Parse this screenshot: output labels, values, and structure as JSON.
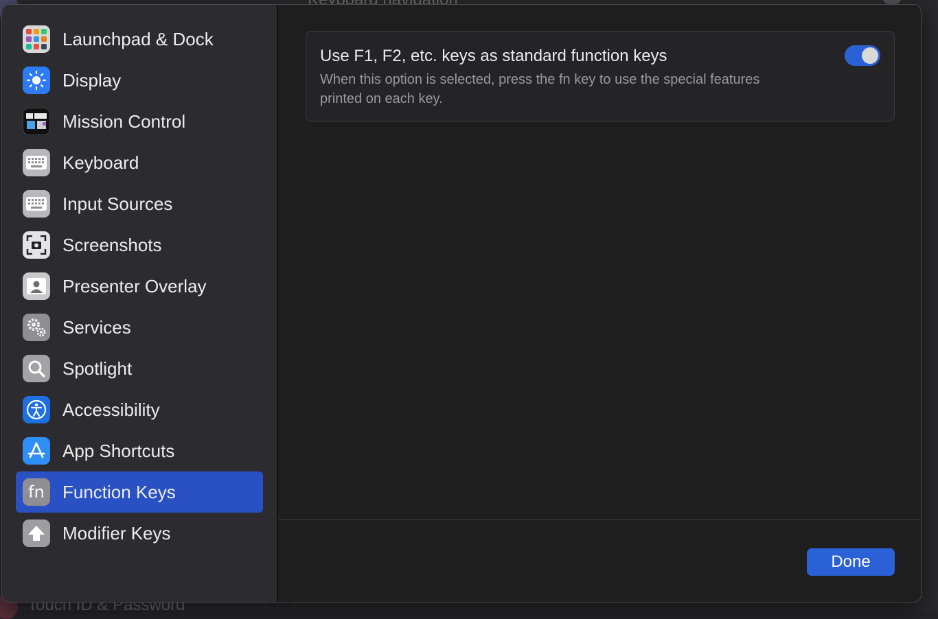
{
  "background": {
    "top_text": "Keyboard navigation",
    "bottom_text": "Touch ID & Password"
  },
  "sidebar": {
    "items": [
      {
        "label": "Launchpad & Dock",
        "icon": "launchpad-icon"
      },
      {
        "label": "Display",
        "icon": "display-icon"
      },
      {
        "label": "Mission Control",
        "icon": "mission-control-icon"
      },
      {
        "label": "Keyboard",
        "icon": "keyboard-icon"
      },
      {
        "label": "Input Sources",
        "icon": "input-sources-icon"
      },
      {
        "label": "Screenshots",
        "icon": "screenshots-icon"
      },
      {
        "label": "Presenter Overlay",
        "icon": "presenter-overlay-icon"
      },
      {
        "label": "Services",
        "icon": "services-icon"
      },
      {
        "label": "Spotlight",
        "icon": "spotlight-icon"
      },
      {
        "label": "Accessibility",
        "icon": "accessibility-icon"
      },
      {
        "label": "App Shortcuts",
        "icon": "app-shortcuts-icon"
      },
      {
        "label": "Function Keys",
        "icon": "function-keys-icon",
        "selected": true
      },
      {
        "label": "Modifier Keys",
        "icon": "modifier-keys-icon"
      }
    ],
    "fn_glyph": "fn"
  },
  "main": {
    "option": {
      "title": "Use F1, F2, etc. keys as standard function keys",
      "description": "When this option is selected, press the fn key to use the special features printed on each key.",
      "enabled": true
    }
  },
  "footer": {
    "done_label": "Done"
  },
  "colors": {
    "accent": "#2a61d6",
    "selection": "#2a51c4"
  }
}
